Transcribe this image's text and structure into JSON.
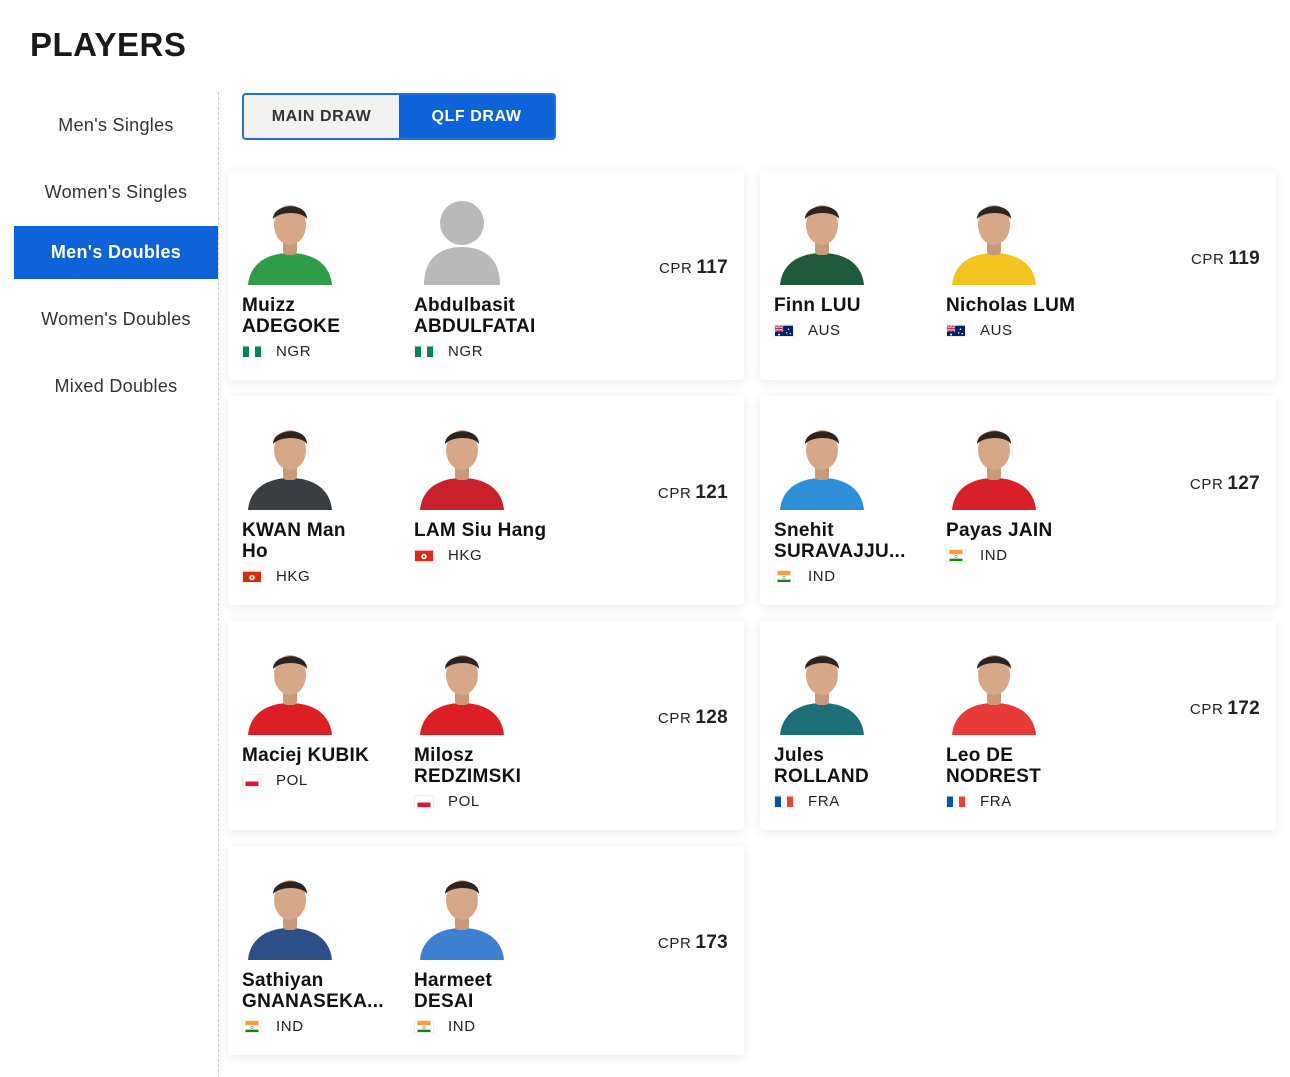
{
  "page_title": "PLAYERS",
  "sidebar": {
    "items": [
      {
        "label": "Men's Singles",
        "active": false
      },
      {
        "label": "Women's Singles",
        "active": false
      },
      {
        "label": "Men's Doubles",
        "active": true
      },
      {
        "label": "Women's Doubles",
        "active": false
      },
      {
        "label": "Mixed Doubles",
        "active": false
      }
    ]
  },
  "draw_toggle": {
    "main_label": "MAIN DRAW",
    "qlf_label": "QLF DRAW",
    "selected": "QLF DRAW"
  },
  "cpr_label": "CPR",
  "pairs": [
    {
      "cpr": "117",
      "players": [
        {
          "name": "Muizz\nADEGOKE",
          "country": "NGR",
          "flag": "nga",
          "photo": true
        },
        {
          "name": "Abdulbasit\nABDULFATAI",
          "country": "NGR",
          "flag": "nga",
          "photo": false
        }
      ]
    },
    {
      "cpr": "119",
      "players": [
        {
          "name": "Finn LUU",
          "country": "AUS",
          "flag": "aus",
          "photo": true
        },
        {
          "name": "Nicholas LUM",
          "country": "AUS",
          "flag": "aus",
          "photo": true
        }
      ]
    },
    {
      "cpr": "121",
      "players": [
        {
          "name": "KWAN Man\nHo",
          "country": "HKG",
          "flag": "hkg",
          "photo": true
        },
        {
          "name": "LAM Siu Hang",
          "country": "HKG",
          "flag": "hkg",
          "photo": true
        }
      ]
    },
    {
      "cpr": "127",
      "players": [
        {
          "name": "Snehit\nSURAVAJJU...",
          "country": "IND",
          "flag": "ind",
          "photo": true
        },
        {
          "name": "Payas JAIN",
          "country": "IND",
          "flag": "ind",
          "photo": true
        }
      ]
    },
    {
      "cpr": "128",
      "players": [
        {
          "name": "Maciej KUBIK",
          "country": "POL",
          "flag": "pol",
          "photo": true
        },
        {
          "name": "Milosz\nREDZIMSKI",
          "country": "POL",
          "flag": "pol",
          "photo": true
        }
      ]
    },
    {
      "cpr": "172",
      "players": [
        {
          "name": "Jules\nROLLAND",
          "country": "FRA",
          "flag": "fra",
          "photo": true
        },
        {
          "name": "Leo DE\nNODREST",
          "country": "FRA",
          "flag": "fra",
          "photo": true
        }
      ]
    },
    {
      "cpr": "173",
      "players": [
        {
          "name": "Sathiyan\nGNANASEKA...",
          "country": "IND",
          "flag": "ind",
          "photo": true
        },
        {
          "name": "Harmeet\nDESAI",
          "country": "IND",
          "flag": "ind",
          "photo": true
        }
      ]
    }
  ],
  "colors": {
    "accent": "#0f63d8",
    "placeholder_avatar": "#b9b9b9",
    "jersey_ngr": "#2f9c4a",
    "jersey_aus_1": "#1f5b3a",
    "jersey_aus_2": "#f2c321",
    "jersey_hkg_1": "#3a3f44",
    "jersey_hkg_2": "#c8202d",
    "jersey_ind_1": "#2e8fd8",
    "jersey_ind_2": "#d8202a",
    "jersey_pol": "#dc1f26",
    "jersey_fra_1": "#1f6f78",
    "jersey_fra_2": "#e8393b",
    "jersey_ind_3": "#2d4f86",
    "jersey_ind_4": "#3d7fd0"
  },
  "jerseys": [
    "jersey_ngr",
    "placeholder_avatar",
    "jersey_aus_1",
    "jersey_aus_2",
    "jersey_hkg_1",
    "jersey_hkg_2",
    "jersey_ind_1",
    "jersey_ind_2",
    "jersey_pol",
    "jersey_pol",
    "jersey_fra_1",
    "jersey_fra_2",
    "jersey_ind_3",
    "jersey_ind_4"
  ]
}
